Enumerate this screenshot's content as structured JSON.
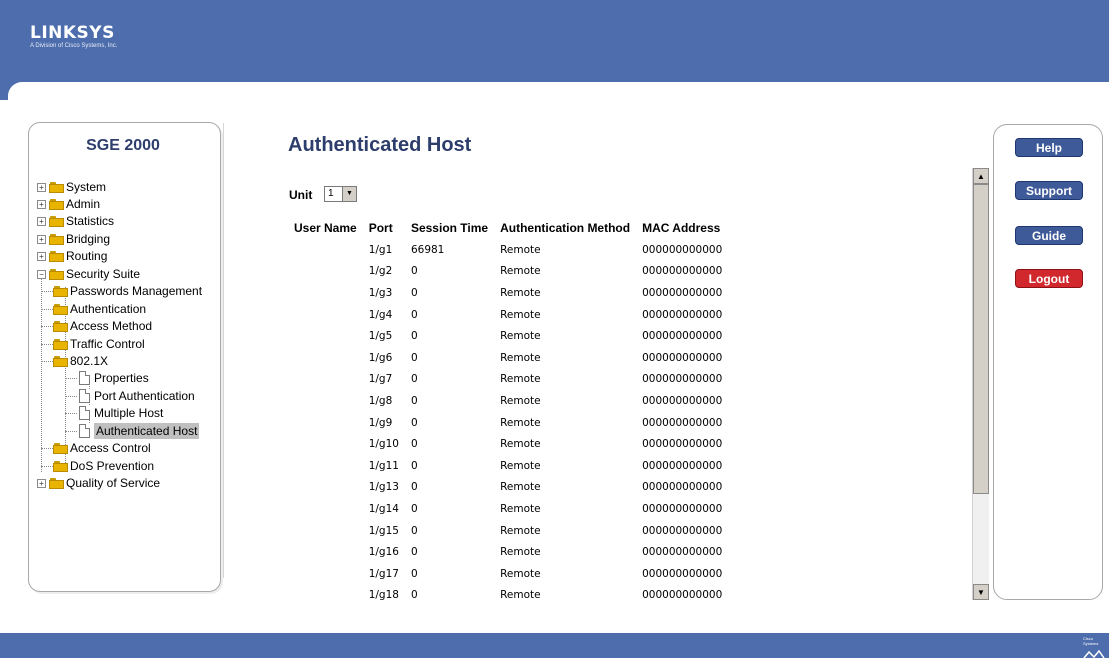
{
  "brand": {
    "name": "LINKSYS",
    "subtitle": "A Division of Cisco Systems, Inc.",
    "footer_mark": "Cisco Systems"
  },
  "product": "SGE 2000",
  "nav": {
    "items": [
      {
        "label": "System",
        "type": "folder",
        "expanded": false
      },
      {
        "label": "Admin",
        "type": "folder",
        "expanded": false
      },
      {
        "label": "Statistics",
        "type": "folder",
        "expanded": false
      },
      {
        "label": "Bridging",
        "type": "folder",
        "expanded": false
      },
      {
        "label": "Routing",
        "type": "folder",
        "expanded": false
      },
      {
        "label": "Security Suite",
        "type": "folder",
        "expanded": true
      },
      {
        "label": "Passwords Management",
        "type": "folder"
      },
      {
        "label": "Authentication",
        "type": "folder"
      },
      {
        "label": "Access Method",
        "type": "folder"
      },
      {
        "label": "Traffic Control",
        "type": "folder"
      },
      {
        "label": "802.1X",
        "type": "folder",
        "expanded": true
      },
      {
        "label": "Properties",
        "type": "page"
      },
      {
        "label": "Port Authentication",
        "type": "page"
      },
      {
        "label": "Multiple Host",
        "type": "page"
      },
      {
        "label": "Authenticated Host",
        "type": "page",
        "selected": true
      },
      {
        "label": "Access Control",
        "type": "folder"
      },
      {
        "label": "DoS Prevention",
        "type": "folder"
      },
      {
        "label": "Quality of Service",
        "type": "folder",
        "expanded": false
      }
    ]
  },
  "page": {
    "title": "Authenticated Host",
    "unit_label": "Unit",
    "unit_value": "1",
    "table": {
      "headers": [
        "User Name",
        "Port",
        "Session Time",
        "Authentication Method",
        "MAC Address"
      ],
      "rows": [
        [
          "",
          "1/g1",
          "66981",
          "Remote",
          "000000000000"
        ],
        [
          "",
          "1/g2",
          "0",
          "Remote",
          "000000000000"
        ],
        [
          "",
          "1/g3",
          "0",
          "Remote",
          "000000000000"
        ],
        [
          "",
          "1/g4",
          "0",
          "Remote",
          "000000000000"
        ],
        [
          "",
          "1/g5",
          "0",
          "Remote",
          "000000000000"
        ],
        [
          "",
          "1/g6",
          "0",
          "Remote",
          "000000000000"
        ],
        [
          "",
          "1/g7",
          "0",
          "Remote",
          "000000000000"
        ],
        [
          "",
          "1/g8",
          "0",
          "Remote",
          "000000000000"
        ],
        [
          "",
          "1/g9",
          "0",
          "Remote",
          "000000000000"
        ],
        [
          "",
          "1/g10",
          "0",
          "Remote",
          "000000000000"
        ],
        [
          "",
          "1/g11",
          "0",
          "Remote",
          "000000000000"
        ],
        [
          "",
          "1/g13",
          "0",
          "Remote",
          "000000000000"
        ],
        [
          "",
          "1/g14",
          "0",
          "Remote",
          "000000000000"
        ],
        [
          "",
          "1/g15",
          "0",
          "Remote",
          "000000000000"
        ],
        [
          "",
          "1/g16",
          "0",
          "Remote",
          "000000000000"
        ],
        [
          "",
          "1/g17",
          "0",
          "Remote",
          "000000000000"
        ],
        [
          "",
          "1/g18",
          "0",
          "Remote",
          "000000000000"
        ]
      ]
    }
  },
  "side_buttons": {
    "help": "Help",
    "support": "Support",
    "guide": "Guide",
    "logout": "Logout"
  },
  "colors": {
    "header_blue": "#4d6dad",
    "title_navy": "#2d3d6c",
    "button_blue": "#3f5a98",
    "logout_red": "#d1282e",
    "folder_yellow": "#e8b400"
  },
  "icons": {
    "folder": "folder-icon",
    "page": "page-icon",
    "expand": "plus-box-icon",
    "collapse": "minus-box-icon"
  }
}
